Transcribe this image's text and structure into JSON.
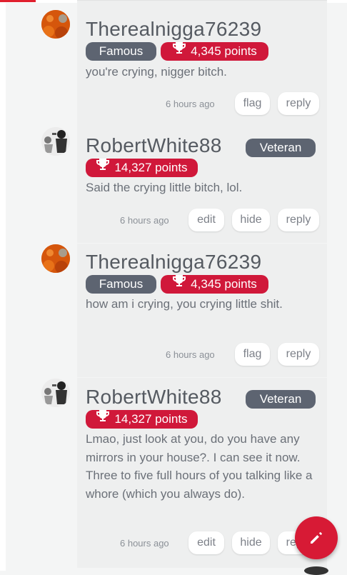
{
  "comments": [
    {
      "username": "Therealnigga76239",
      "role_badge": "Famous",
      "points": "4,345 points",
      "text": "you're crying, nigger bitch.",
      "time": "6 hours ago",
      "actions": [
        "flag",
        "reply"
      ]
    },
    {
      "username": "RobertWhite88",
      "role_badge": "Veteran",
      "points": "14,327 points",
      "text": "Said the crying little bitch, lol.",
      "time": "6 hours ago",
      "actions": [
        "edit",
        "hide",
        "reply"
      ]
    },
    {
      "username": "Therealnigga76239",
      "role_badge": "Famous",
      "points": "4,345 points",
      "text": "how am i crying, you crying little shit.",
      "time": "6 hours ago",
      "actions": [
        "flag",
        "reply"
      ]
    },
    {
      "username": "RobertWhite88",
      "role_badge": "Veteran",
      "points": "14,327 points",
      "text": "Lmao, just look at you, do you have any mirrors in your house?. I can see it now. Three to five full hours of you talking like a whore (which you always do).",
      "time": "6 hours ago",
      "actions": [
        "edit",
        "hide",
        "reply"
      ]
    }
  ],
  "fab": {
    "icon": "pencil-icon"
  },
  "colors": {
    "accent": "#d0183a",
    "badge_grey": "#5d6471"
  }
}
